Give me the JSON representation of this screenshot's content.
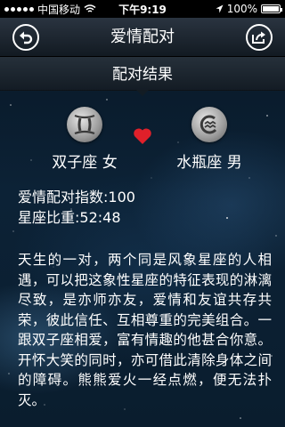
{
  "status_bar": {
    "carrier": "中国移动",
    "time": "下午9:19",
    "battery": "100%"
  },
  "nav": {
    "title": "爱情配对",
    "back_icon": "back-arrow-icon",
    "share_icon": "share-icon"
  },
  "section": {
    "title": "配对结果"
  },
  "match": {
    "left_sign": "双子座 女",
    "right_sign": "水瓶座 男",
    "left_icon": "gemini-icon",
    "right_icon": "aquarius-icon",
    "heart_color": "#e0202a"
  },
  "scores": {
    "love_label": "爱情配对指数: ",
    "love_value": "100",
    "ratio_label": "星座比重: ",
    "ratio_value": "52:48"
  },
  "description": "天生的一对，两个同是风象星座的人相遇，可以把这象性星座的特征表现的淋漓尽致，是亦师亦友，爱情和友谊共存共荣，彼此信任、互相尊重的完美组合。一跟双子座相爱，富有情趣的他甚合你意。开怀大笑的同时，亦可借此清除身体之间的障碍。熊熊爱火一经点燃，便无法扑灭。"
}
